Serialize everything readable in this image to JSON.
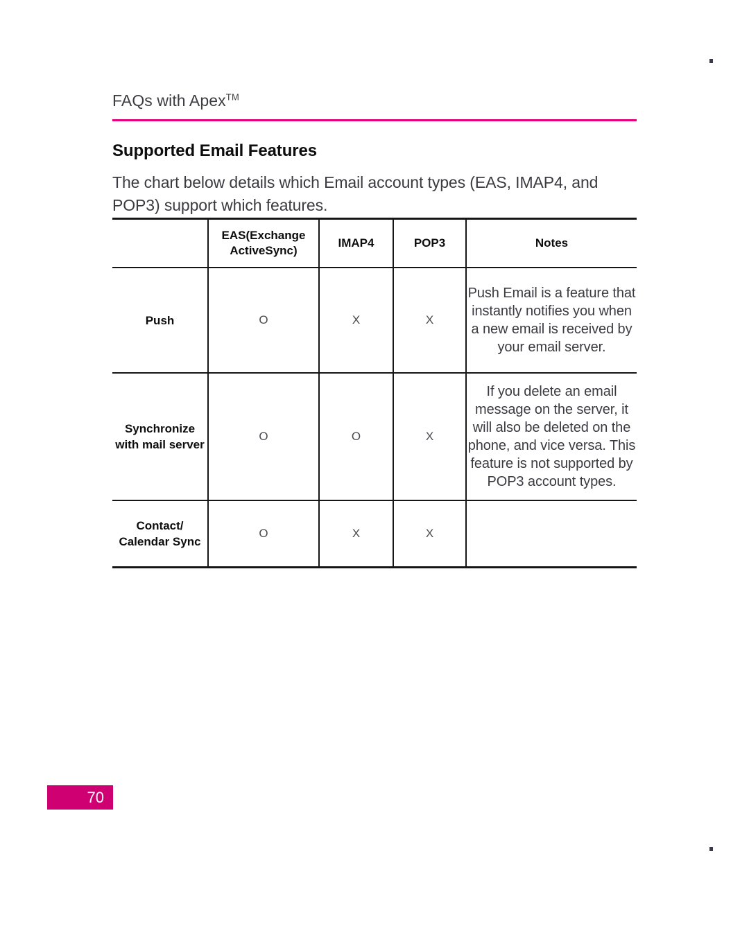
{
  "document": {
    "running_header": "FAQs with Apex",
    "running_header_superscript": "TM",
    "section_title": "Supported Email Features",
    "intro_paragraph": "The chart below details which Email account types (EAS, IMAP4, and POP3) support which features.",
    "page_number": "70",
    "accent_color": "#e5007e",
    "page_badge_color": "#cf0072"
  },
  "table": {
    "headers": [
      "",
      "EAS(Exchange ActiveSync)",
      "IMAP4",
      "POP3",
      "Notes"
    ],
    "rows": [
      {
        "feature": "Push",
        "eas": "O",
        "imap4": "X",
        "pop3": "X",
        "notes": "Push Email is a feature that instantly notifies you when a new email is received by your email server."
      },
      {
        "feature": "Synchronize with mail server",
        "eas": "O",
        "imap4": "O",
        "pop3": "X",
        "notes": "If you delete an email message on the server, it will also be deleted on the phone, and vice versa. This feature is not supported by POP3 account types."
      },
      {
        "feature": "Contact/ Calendar Sync",
        "eas": "O",
        "imap4": "X",
        "pop3": "X",
        "notes": ""
      }
    ]
  }
}
